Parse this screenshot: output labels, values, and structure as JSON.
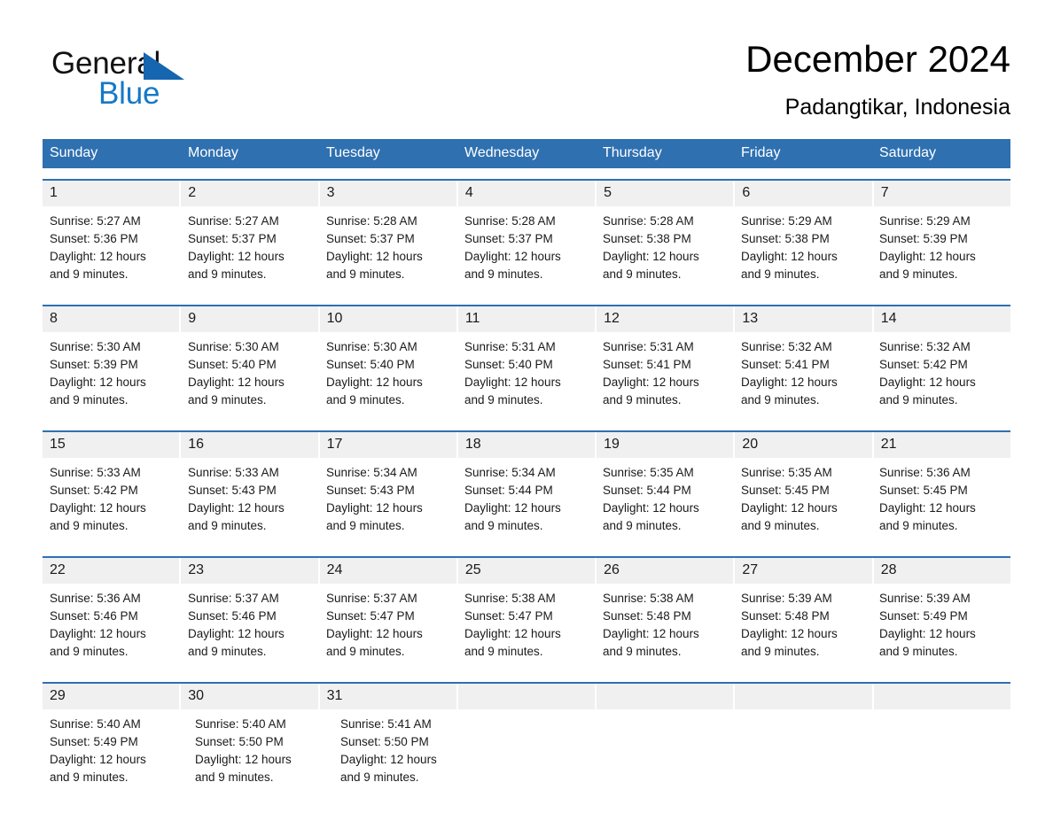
{
  "brand": {
    "name_part1": "General",
    "name_part2": "Blue",
    "accent_color": "#1579c8",
    "triangle_color": "#1565b0"
  },
  "header": {
    "title": "December 2024",
    "subtitle": "Padangtikar, Indonesia"
  },
  "calendar": {
    "header_bg": "#2f70b0",
    "date_strip_bg": "#f0f0f0",
    "weekdays": [
      "Sunday",
      "Monday",
      "Tuesday",
      "Wednesday",
      "Thursday",
      "Friday",
      "Saturday"
    ],
    "weeks": [
      {
        "days": [
          {
            "date": "1",
            "sunrise": "Sunrise: 5:27 AM",
            "sunset": "Sunset: 5:36 PM",
            "daylight_line1": "Daylight: 12 hours",
            "daylight_line2": "and 9 minutes."
          },
          {
            "date": "2",
            "sunrise": "Sunrise: 5:27 AM",
            "sunset": "Sunset: 5:37 PM",
            "daylight_line1": "Daylight: 12 hours",
            "daylight_line2": "and 9 minutes."
          },
          {
            "date": "3",
            "sunrise": "Sunrise: 5:28 AM",
            "sunset": "Sunset: 5:37 PM",
            "daylight_line1": "Daylight: 12 hours",
            "daylight_line2": "and 9 minutes."
          },
          {
            "date": "4",
            "sunrise": "Sunrise: 5:28 AM",
            "sunset": "Sunset: 5:37 PM",
            "daylight_line1": "Daylight: 12 hours",
            "daylight_line2": "and 9 minutes."
          },
          {
            "date": "5",
            "sunrise": "Sunrise: 5:28 AM",
            "sunset": "Sunset: 5:38 PM",
            "daylight_line1": "Daylight: 12 hours",
            "daylight_line2": "and 9 minutes."
          },
          {
            "date": "6",
            "sunrise": "Sunrise: 5:29 AM",
            "sunset": "Sunset: 5:38 PM",
            "daylight_line1": "Daylight: 12 hours",
            "daylight_line2": "and 9 minutes."
          },
          {
            "date": "7",
            "sunrise": "Sunrise: 5:29 AM",
            "sunset": "Sunset: 5:39 PM",
            "daylight_line1": "Daylight: 12 hours",
            "daylight_line2": "and 9 minutes."
          }
        ]
      },
      {
        "days": [
          {
            "date": "8",
            "sunrise": "Sunrise: 5:30 AM",
            "sunset": "Sunset: 5:39 PM",
            "daylight_line1": "Daylight: 12 hours",
            "daylight_line2": "and 9 minutes."
          },
          {
            "date": "9",
            "sunrise": "Sunrise: 5:30 AM",
            "sunset": "Sunset: 5:40 PM",
            "daylight_line1": "Daylight: 12 hours",
            "daylight_line2": "and 9 minutes."
          },
          {
            "date": "10",
            "sunrise": "Sunrise: 5:30 AM",
            "sunset": "Sunset: 5:40 PM",
            "daylight_line1": "Daylight: 12 hours",
            "daylight_line2": "and 9 minutes."
          },
          {
            "date": "11",
            "sunrise": "Sunrise: 5:31 AM",
            "sunset": "Sunset: 5:40 PM",
            "daylight_line1": "Daylight: 12 hours",
            "daylight_line2": "and 9 minutes."
          },
          {
            "date": "12",
            "sunrise": "Sunrise: 5:31 AM",
            "sunset": "Sunset: 5:41 PM",
            "daylight_line1": "Daylight: 12 hours",
            "daylight_line2": "and 9 minutes."
          },
          {
            "date": "13",
            "sunrise": "Sunrise: 5:32 AM",
            "sunset": "Sunset: 5:41 PM",
            "daylight_line1": "Daylight: 12 hours",
            "daylight_line2": "and 9 minutes."
          },
          {
            "date": "14",
            "sunrise": "Sunrise: 5:32 AM",
            "sunset": "Sunset: 5:42 PM",
            "daylight_line1": "Daylight: 12 hours",
            "daylight_line2": "and 9 minutes."
          }
        ]
      },
      {
        "days": [
          {
            "date": "15",
            "sunrise": "Sunrise: 5:33 AM",
            "sunset": "Sunset: 5:42 PM",
            "daylight_line1": "Daylight: 12 hours",
            "daylight_line2": "and 9 minutes."
          },
          {
            "date": "16",
            "sunrise": "Sunrise: 5:33 AM",
            "sunset": "Sunset: 5:43 PM",
            "daylight_line1": "Daylight: 12 hours",
            "daylight_line2": "and 9 minutes."
          },
          {
            "date": "17",
            "sunrise": "Sunrise: 5:34 AM",
            "sunset": "Sunset: 5:43 PM",
            "daylight_line1": "Daylight: 12 hours",
            "daylight_line2": "and 9 minutes."
          },
          {
            "date": "18",
            "sunrise": "Sunrise: 5:34 AM",
            "sunset": "Sunset: 5:44 PM",
            "daylight_line1": "Daylight: 12 hours",
            "daylight_line2": "and 9 minutes."
          },
          {
            "date": "19",
            "sunrise": "Sunrise: 5:35 AM",
            "sunset": "Sunset: 5:44 PM",
            "daylight_line1": "Daylight: 12 hours",
            "daylight_line2": "and 9 minutes."
          },
          {
            "date": "20",
            "sunrise": "Sunrise: 5:35 AM",
            "sunset": "Sunset: 5:45 PM",
            "daylight_line1": "Daylight: 12 hours",
            "daylight_line2": "and 9 minutes."
          },
          {
            "date": "21",
            "sunrise": "Sunrise: 5:36 AM",
            "sunset": "Sunset: 5:45 PM",
            "daylight_line1": "Daylight: 12 hours",
            "daylight_line2": "and 9 minutes."
          }
        ]
      },
      {
        "days": [
          {
            "date": "22",
            "sunrise": "Sunrise: 5:36 AM",
            "sunset": "Sunset: 5:46 PM",
            "daylight_line1": "Daylight: 12 hours",
            "daylight_line2": "and 9 minutes."
          },
          {
            "date": "23",
            "sunrise": "Sunrise: 5:37 AM",
            "sunset": "Sunset: 5:46 PM",
            "daylight_line1": "Daylight: 12 hours",
            "daylight_line2": "and 9 minutes."
          },
          {
            "date": "24",
            "sunrise": "Sunrise: 5:37 AM",
            "sunset": "Sunset: 5:47 PM",
            "daylight_line1": "Daylight: 12 hours",
            "daylight_line2": "and 9 minutes."
          },
          {
            "date": "25",
            "sunrise": "Sunrise: 5:38 AM",
            "sunset": "Sunset: 5:47 PM",
            "daylight_line1": "Daylight: 12 hours",
            "daylight_line2": "and 9 minutes."
          },
          {
            "date": "26",
            "sunrise": "Sunrise: 5:38 AM",
            "sunset": "Sunset: 5:48 PM",
            "daylight_line1": "Daylight: 12 hours",
            "daylight_line2": "and 9 minutes."
          },
          {
            "date": "27",
            "sunrise": "Sunrise: 5:39 AM",
            "sunset": "Sunset: 5:48 PM",
            "daylight_line1": "Daylight: 12 hours",
            "daylight_line2": "and 9 minutes."
          },
          {
            "date": "28",
            "sunrise": "Sunrise: 5:39 AM",
            "sunset": "Sunset: 5:49 PM",
            "daylight_line1": "Daylight: 12 hours",
            "daylight_line2": "and 9 minutes."
          }
        ]
      },
      {
        "days": [
          {
            "date": "29",
            "sunrise": "Sunrise: 5:40 AM",
            "sunset": "Sunset: 5:49 PM",
            "daylight_line1": "Daylight: 12 hours",
            "daylight_line2": "and 9 minutes."
          },
          {
            "date": "30",
            "sunrise": "Sunrise: 5:40 AM",
            "sunset": "Sunset: 5:50 PM",
            "daylight_line1": "Daylight: 12 hours",
            "daylight_line2": "and 9 minutes."
          },
          {
            "date": "31",
            "sunrise": "Sunrise: 5:41 AM",
            "sunset": "Sunset: 5:50 PM",
            "daylight_line1": "Daylight: 12 hours",
            "daylight_line2": "and 9 minutes."
          },
          {
            "date": "",
            "sunrise": "",
            "sunset": "",
            "daylight_line1": "",
            "daylight_line2": ""
          },
          {
            "date": "",
            "sunrise": "",
            "sunset": "",
            "daylight_line1": "",
            "daylight_line2": ""
          },
          {
            "date": "",
            "sunrise": "",
            "sunset": "",
            "daylight_line1": "",
            "daylight_line2": ""
          },
          {
            "date": "",
            "sunrise": "",
            "sunset": "",
            "daylight_line1": "",
            "daylight_line2": ""
          }
        ]
      }
    ]
  }
}
